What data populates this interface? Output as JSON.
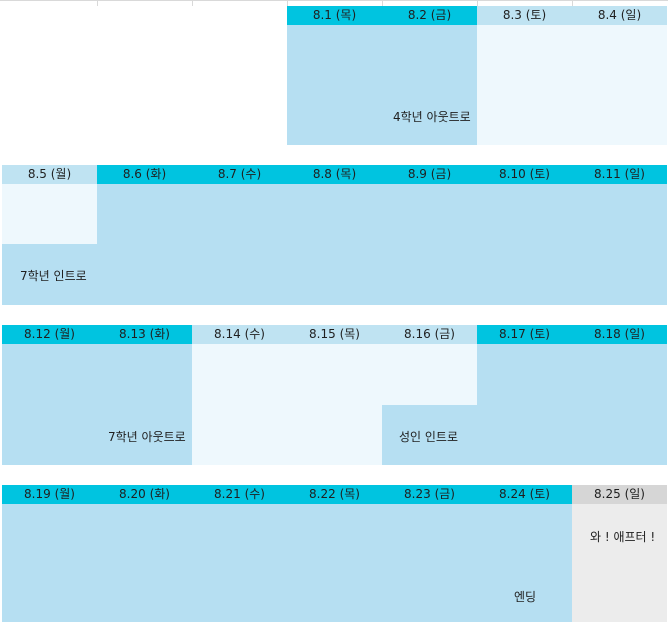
{
  "week1": {
    "days": [
      "8.1 (목)",
      "8.2 (금)",
      "8.3 (토)",
      "8.4 (일)"
    ],
    "events": {
      "outro_4": "4학년 아웃트로"
    }
  },
  "week2": {
    "days": [
      "8.5 (월)",
      "8.6 (화)",
      "8.7 (수)",
      "8.8 (목)",
      "8.9 (금)",
      "8.10 (토)",
      "8.11 (일)"
    ],
    "events": {
      "intro_7": "7학년 인트로"
    }
  },
  "week3": {
    "days": [
      "8.12 (월)",
      "8.13 (화)",
      "8.14 (수)",
      "8.15 (목)",
      "8.16 (금)",
      "8.17 (토)",
      "8.18 (일)"
    ],
    "events": {
      "outro_7": "7학년 아웃트로",
      "intro_adult": "성인 인트로"
    }
  },
  "week4": {
    "days": [
      "8.19 (월)",
      "8.20 (화)",
      "8.21 (수)",
      "8.22 (목)",
      "8.23 (금)",
      "8.24 (토)",
      "8.25 (일)"
    ],
    "events": {
      "ending": "엔딩",
      "wow": "와 ! 애프터 !"
    }
  },
  "colors": {
    "header_cyan": "#00c4e0",
    "header_light": "#bfe3f2",
    "header_gray": "#d6d6d6",
    "block_main": "#b6dff2",
    "block_pale": "#eef8fd",
    "block_gray": "#ececec"
  }
}
